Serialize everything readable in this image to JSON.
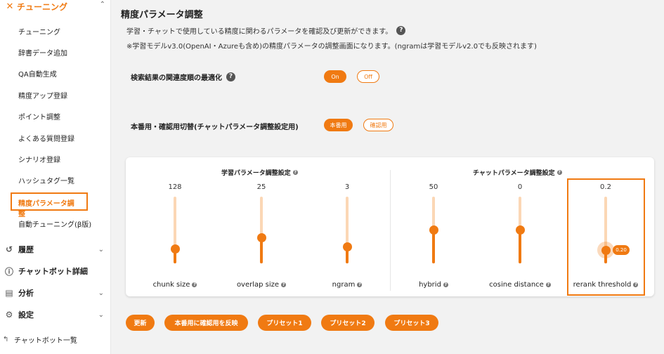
{
  "sidebar": {
    "header": {
      "icon": "✕",
      "label": "チューニング",
      "chevron": "⌃"
    },
    "sub_items": [
      {
        "label": "チューニング"
      },
      {
        "label": "辞書データ追加"
      },
      {
        "label": "QA自動生成"
      },
      {
        "label": "精度アップ登録"
      },
      {
        "label": "ポイント調整"
      },
      {
        "label": "よくある質問登録"
      },
      {
        "label": "シナリオ登録"
      },
      {
        "label": "ハッシュタグ一覧"
      },
      {
        "label": "精度パラメータ調整"
      },
      {
        "label": "自動チューニング(β版)"
      }
    ],
    "main_items": [
      {
        "icon": "↺",
        "label": "履歴",
        "chevron": "⌄"
      },
      {
        "icon": "ⓘ",
        "label": "チャットボット詳細",
        "chevron": ""
      },
      {
        "icon": "▤",
        "label": "分析",
        "chevron": "⌄"
      },
      {
        "icon": "⚙",
        "label": "設定",
        "chevron": "⌄"
      }
    ],
    "bottom": {
      "icon": "↰",
      "label": "チャットボット一覧"
    }
  },
  "page": {
    "title": "精度パラメータ調整",
    "desc1": "学習・チャットで使用している精度に関わるパラメータを確認及び更新ができます。",
    "desc2": "※学習モデルv3.0(OpenAI・Azureも含め)の精度パラメータの調整画面になります。(ngramは学習モデルv2.0でも反映されます)",
    "help": "?"
  },
  "setting1": {
    "label": "検索結果の関連度順の最適化",
    "on": "On",
    "off": "Off",
    "selected": "On"
  },
  "setting2": {
    "label": "本番用・確認用切替(チャットパラメータ調整設定用)",
    "on": "本番用",
    "off": "確認用",
    "selected": "本番用"
  },
  "panel": {
    "learning_title": "学習パラメータ調整設定",
    "chat_title": "チャットパラメータ調整設定",
    "sliders": [
      {
        "name": "chunk size",
        "value": "128",
        "level": 0.22
      },
      {
        "name": "overlap size",
        "value": "25",
        "level": 0.38
      },
      {
        "name": "ngram",
        "value": "3",
        "level": 0.25
      },
      {
        "name": "hybrid",
        "value": "50",
        "level": 0.5
      },
      {
        "name": "cosine distance",
        "value": "0",
        "level": 0.5
      },
      {
        "name": "rerank threshold",
        "value": "0.2",
        "level": 0.2,
        "tooltip": "0.20"
      }
    ]
  },
  "buttons": {
    "update": "更新",
    "apply_prod": "本番用に確認用を反映",
    "preset1": "プリセット1",
    "preset2": "プリセット2",
    "preset3": "プリセット3"
  },
  "colors": {
    "accent": "#f07a12",
    "track": "#fbd7b5"
  }
}
